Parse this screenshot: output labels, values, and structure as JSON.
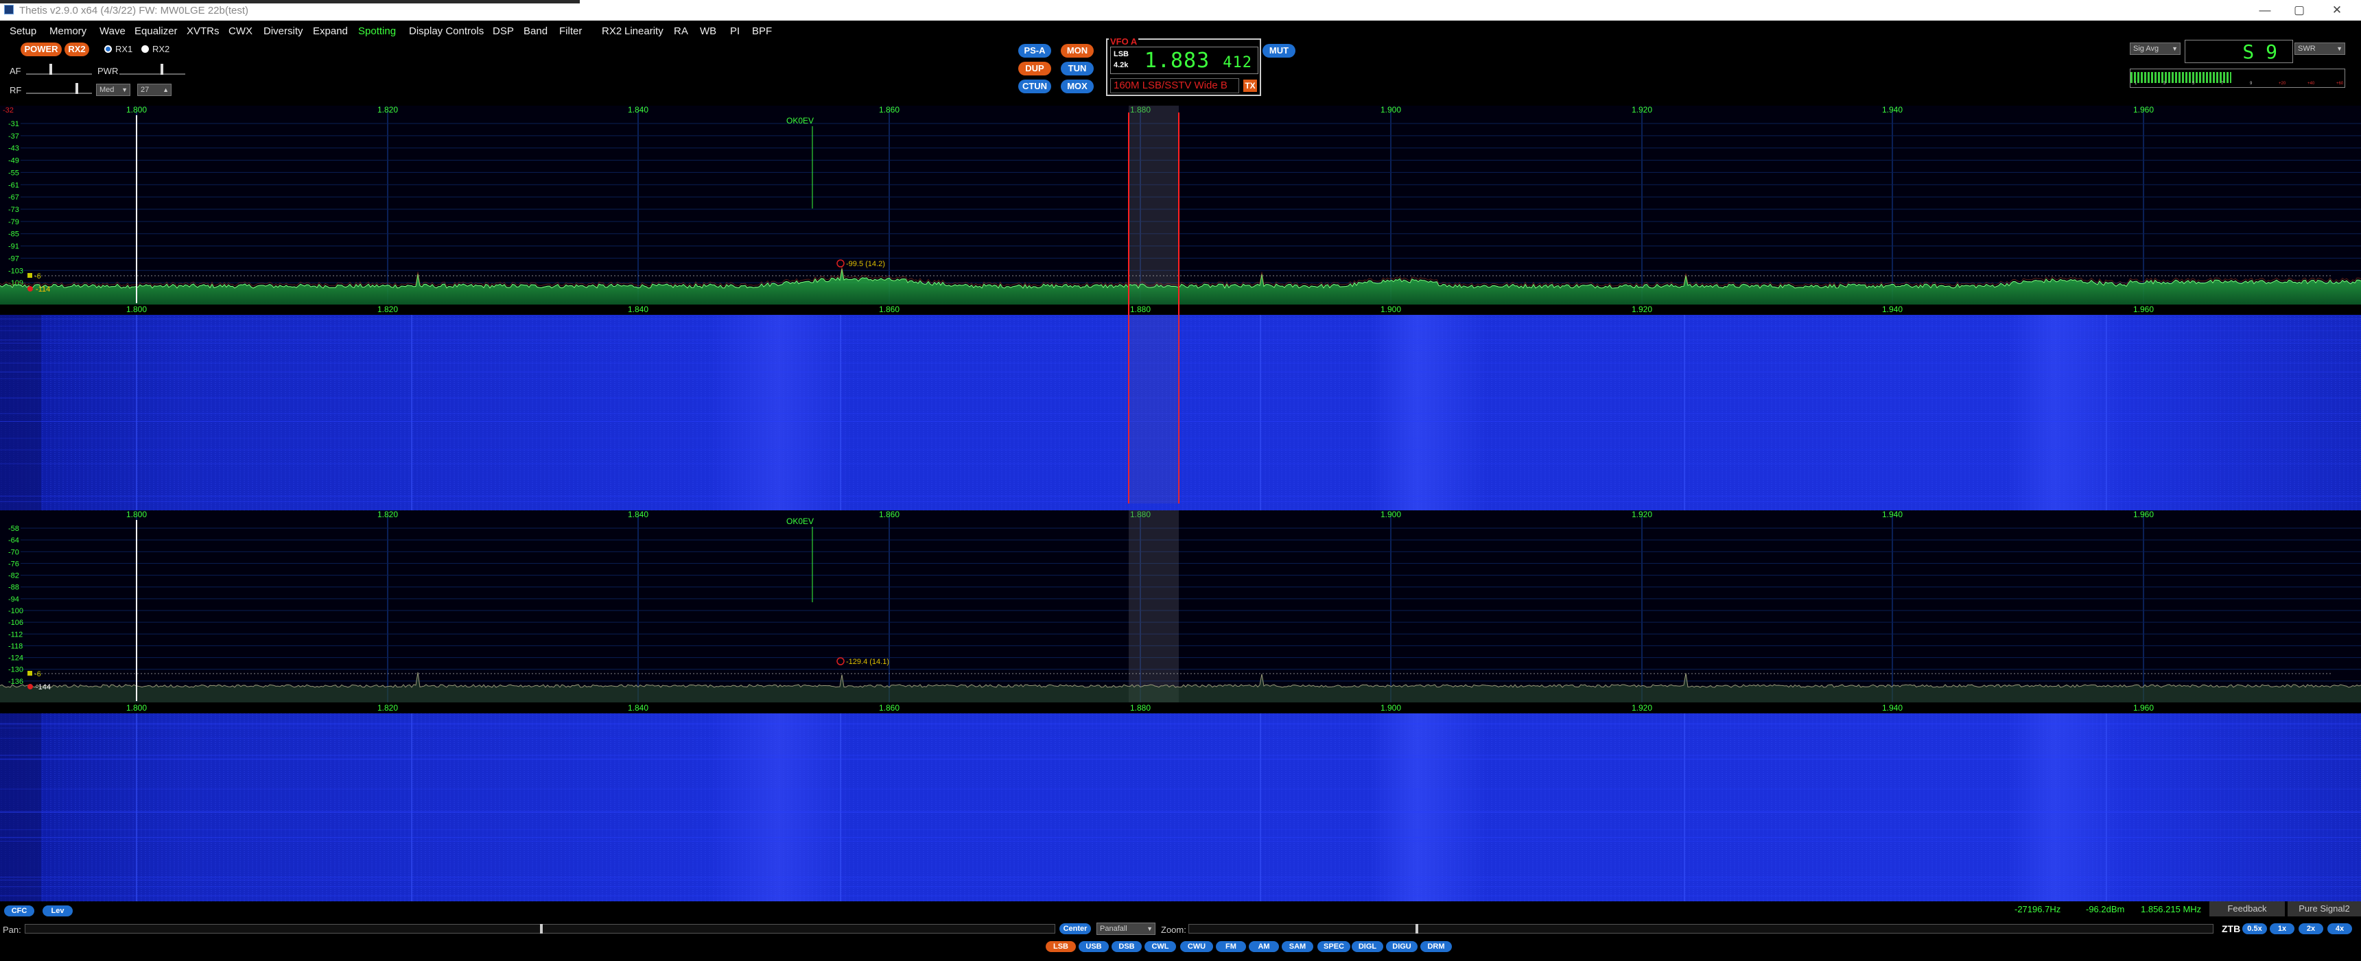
{
  "window": {
    "title": "Thetis v2.9.0 x64 (4/3/22) FW: MW0LGE 22b(test)",
    "minimize": "—",
    "maximize": "▢",
    "close": "✕"
  },
  "menu": [
    "Setup",
    "Memory",
    "Wave",
    "Equalizer",
    "XVTRs",
    "CWX",
    "Diversity",
    "Expand",
    "Spotting",
    "Display Controls",
    "DSP",
    "Band",
    "Filter",
    "RX2",
    "Linearity",
    "RA",
    "WB",
    "PI",
    "BPF"
  ],
  "menu_active": "Spotting",
  "controls": {
    "power": "POWER",
    "rx2_button": "RX2",
    "rx1_radio": "RX1",
    "rx2_radio": "RX2",
    "af": "AF",
    "pwr": "PWR",
    "rf": "RF",
    "agc": "Med",
    "agc_value": "27",
    "ps_a": "PS-A",
    "mon": "MON",
    "dup": "DUP",
    "tun": "TUN",
    "ctun": "CTUN",
    "mox": "MOX",
    "mut": "MUT"
  },
  "vfo": {
    "label": "VFO A",
    "mode": "LSB",
    "bandwidth": "4.2k",
    "freq_main": "1.883",
    "freq_sub": "412",
    "band_info": "160M LSB/SSTV Wide B",
    "tx": "TX"
  },
  "meter": {
    "mode": "Sig Avg",
    "value": "S 9",
    "tx_mode": "SWR",
    "level": 0.47,
    "scale": [
      "1",
      "3",
      "5",
      "7",
      "9",
      "+20",
      "+40",
      "+60"
    ]
  },
  "spectrum": {
    "freq_labels": [
      "1.800",
      "1.820",
      "1.840",
      "1.860",
      "1.880",
      "1.900",
      "1.920",
      "1.940",
      "1.960"
    ],
    "rx1_db_labels": [
      "-31",
      "-37",
      "-43",
      "-49",
      "-55",
      "-61",
      "-67",
      "-73",
      "-79",
      "-85",
      "-91",
      "-97",
      "-103",
      "-109"
    ],
    "rx1_top_db": "-32",
    "rx1_noise": "-114",
    "rx1_squelch": "-6",
    "rx2_db_labels": [
      "-58",
      "-64",
      "-70",
      "-76",
      "-82",
      "-88",
      "-94",
      "-100",
      "-106",
      "-112",
      "-118",
      "-124",
      "-130",
      "-136"
    ],
    "rx2_noise": "-144",
    "rx2_squelch": "-6",
    "spot_label": "OK0EV",
    "rx1_peak": "-99.5 (14.2)",
    "rx2_peak": "-129.4 (14.1)"
  },
  "bottom": {
    "cfc": "CFC",
    "lev": "Lev",
    "pan": "Pan:",
    "center": "Center",
    "display_mode": "Panafall",
    "zoom": "Zoom:",
    "status_offset": "-27196.7Hz",
    "status_dbm": "-96.2dBm",
    "status_freq": "1.856.215 MHz",
    "feedback": "Feedback",
    "pure_signal": "Pure Signal2",
    "ztb": "ZTB",
    "zoom_levels": [
      "0.5x",
      "1x",
      "2x",
      "4x"
    ],
    "modes": [
      "LSB",
      "USB",
      "DSB",
      "CWL",
      "CWU",
      "FM",
      "AM",
      "SAM",
      "SPEC",
      "DIGL",
      "DIGU",
      "DRM"
    ],
    "active_mode": "LSB"
  }
}
